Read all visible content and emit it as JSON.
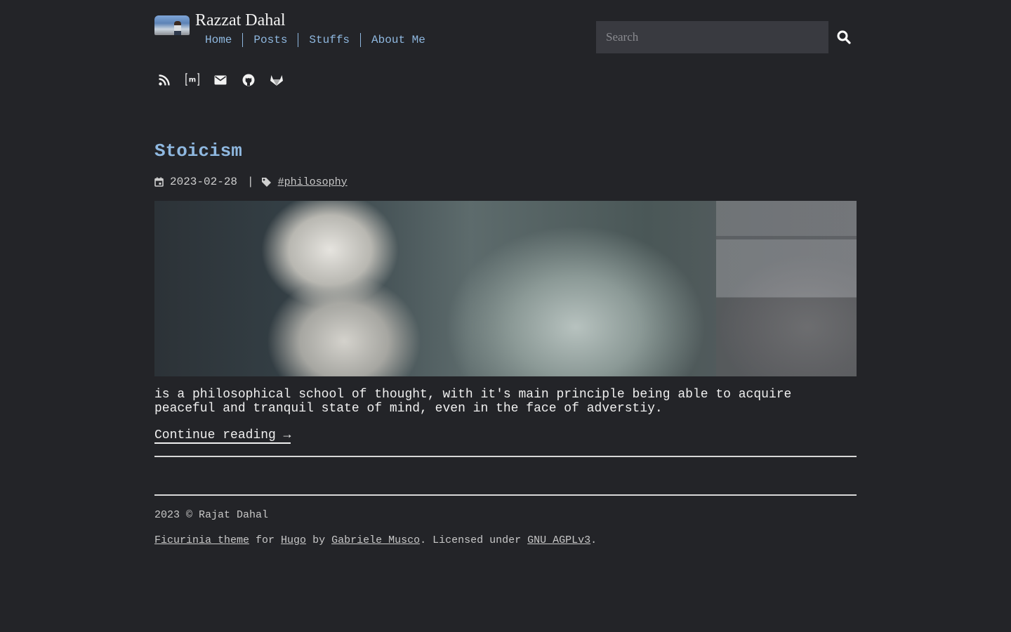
{
  "header": {
    "site_title": "Razzat Dahal",
    "nav": [
      "Home",
      "Posts",
      "Stuffs",
      "About Me"
    ],
    "search_placeholder": "Search",
    "social_icons": [
      "rss-icon",
      "matrix-icon",
      "mail-icon",
      "github-icon",
      "gitlab-icon"
    ]
  },
  "post": {
    "title": "Stoicism",
    "date": "2023-02-28",
    "separator": "|",
    "tag": "#philosophy",
    "excerpt": "is a philosophical school of thought, with it's main principle being able to acquire peaceful and tranquil state of mind, even in the face of adverstiy.",
    "continue_label": "Continue reading →"
  },
  "footer": {
    "copyright": "2023 © Rajat Dahal",
    "theme_link": "Ficurinia theme",
    "for_text": " for ",
    "hugo_link": "Hugo",
    "by_text": " by ",
    "author_link": "Gabriele Musco",
    "licensed_text": ". Licensed under ",
    "license_link": "GNU AGPLv3",
    "end_text": "."
  },
  "colors": {
    "background": "#232428",
    "accent": "#8fb8e0",
    "text": "#f0f0f0"
  }
}
